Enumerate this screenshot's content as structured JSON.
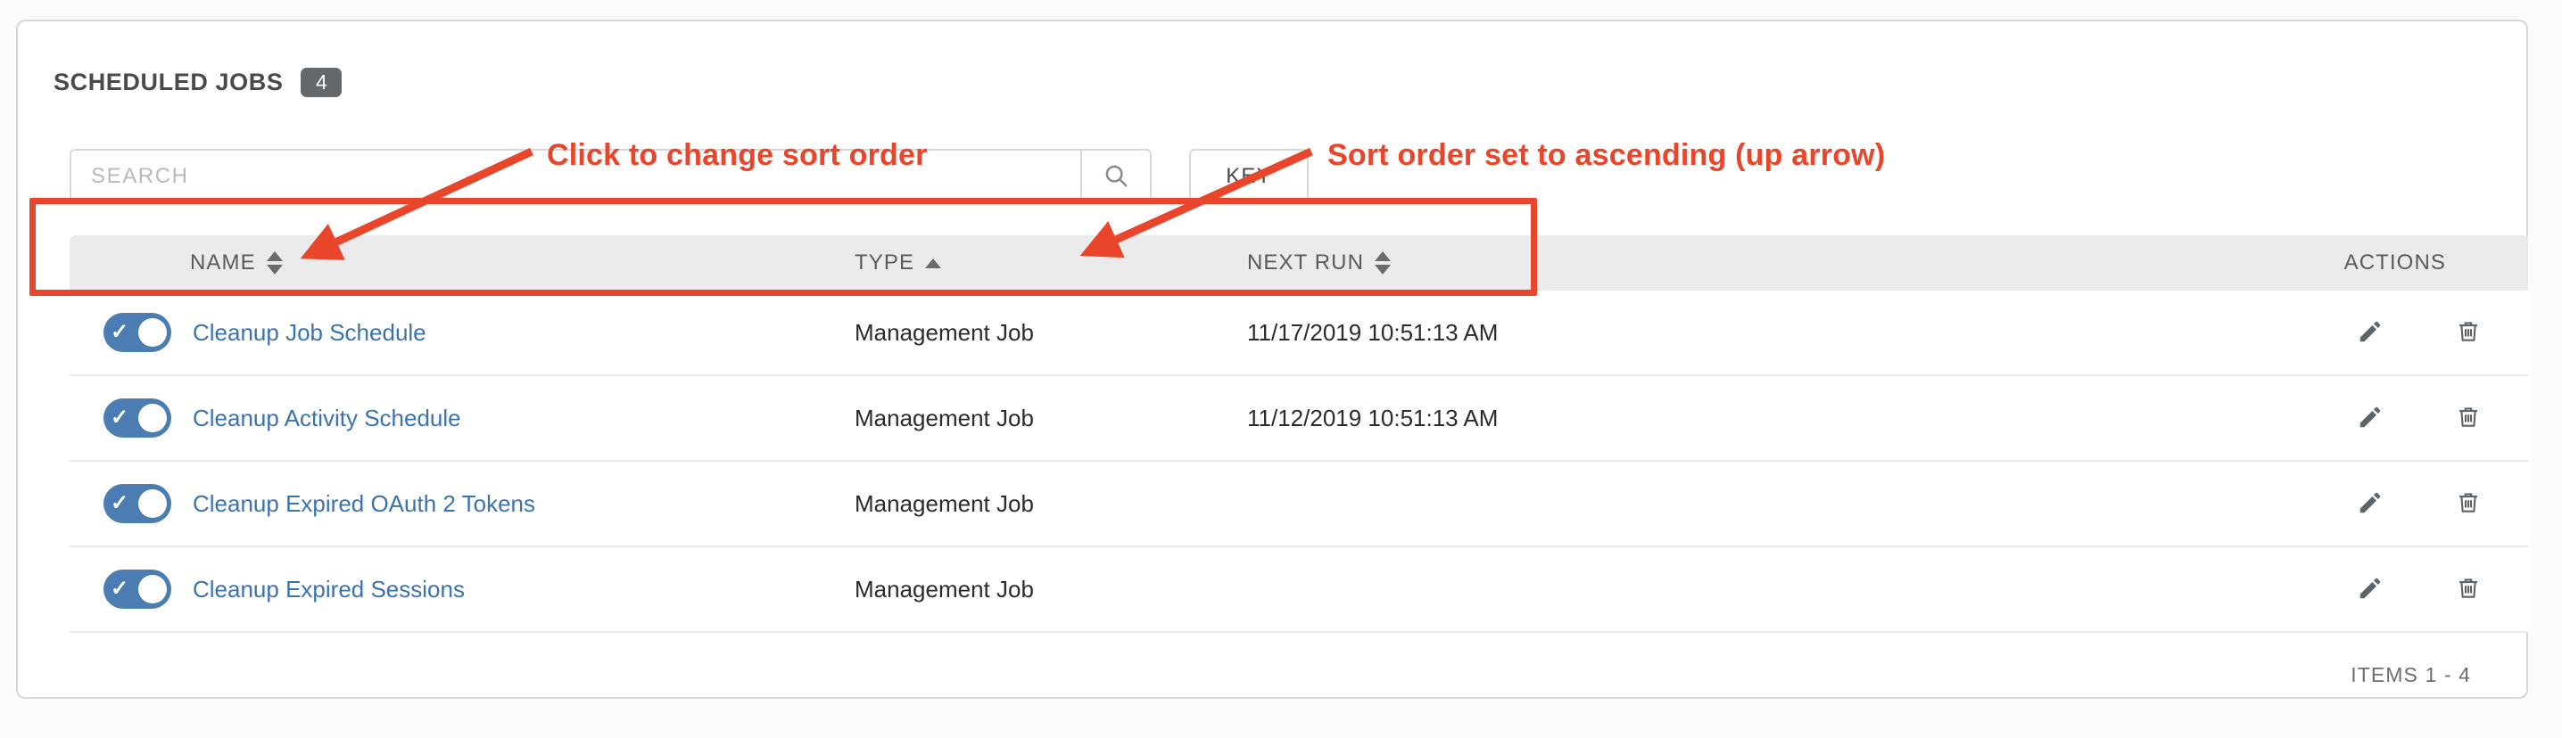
{
  "panel": {
    "title": "SCHEDULED JOBS",
    "count": "4"
  },
  "search": {
    "placeholder": "SEARCH",
    "value": "",
    "search_icon": "search-icon",
    "key_label": "KEY"
  },
  "table": {
    "columns": [
      {
        "label": "NAME",
        "sort": "both"
      },
      {
        "label": "TYPE",
        "sort": "asc"
      },
      {
        "label": "NEXT RUN",
        "sort": "both"
      },
      {
        "label": "ACTIONS",
        "sort": "none"
      }
    ],
    "rows": [
      {
        "enabled": true,
        "name": "Cleanup Job Schedule",
        "type": "Management Job",
        "next_run": "11/17/2019 10:51:13 AM",
        "edit_icon": "pencil-icon",
        "delete_icon": "trash-icon"
      },
      {
        "enabled": true,
        "name": "Cleanup Activity Schedule",
        "type": "Management Job",
        "next_run": "11/12/2019 10:51:13 AM",
        "edit_icon": "pencil-icon",
        "delete_icon": "trash-icon"
      },
      {
        "enabled": true,
        "name": "Cleanup Expired OAuth 2 Tokens",
        "type": "Management Job",
        "next_run": "",
        "edit_icon": "pencil-icon",
        "delete_icon": "trash-icon"
      },
      {
        "enabled": true,
        "name": "Cleanup Expired Sessions",
        "type": "Management Job",
        "next_run": "",
        "edit_icon": "pencil-icon",
        "delete_icon": "trash-icon"
      }
    ],
    "footer": "ITEMS  1 - 4"
  },
  "annotations": [
    {
      "text": "Click to change sort order"
    },
    {
      "text": "Sort order set to ascending (up arrow)"
    }
  ],
  "colors": {
    "annotation": "#e8452a",
    "toggle_on": "#4b7db3",
    "link": "#3b73ad",
    "header_bg": "#ebebeb",
    "badge_bg": "#63686d"
  }
}
